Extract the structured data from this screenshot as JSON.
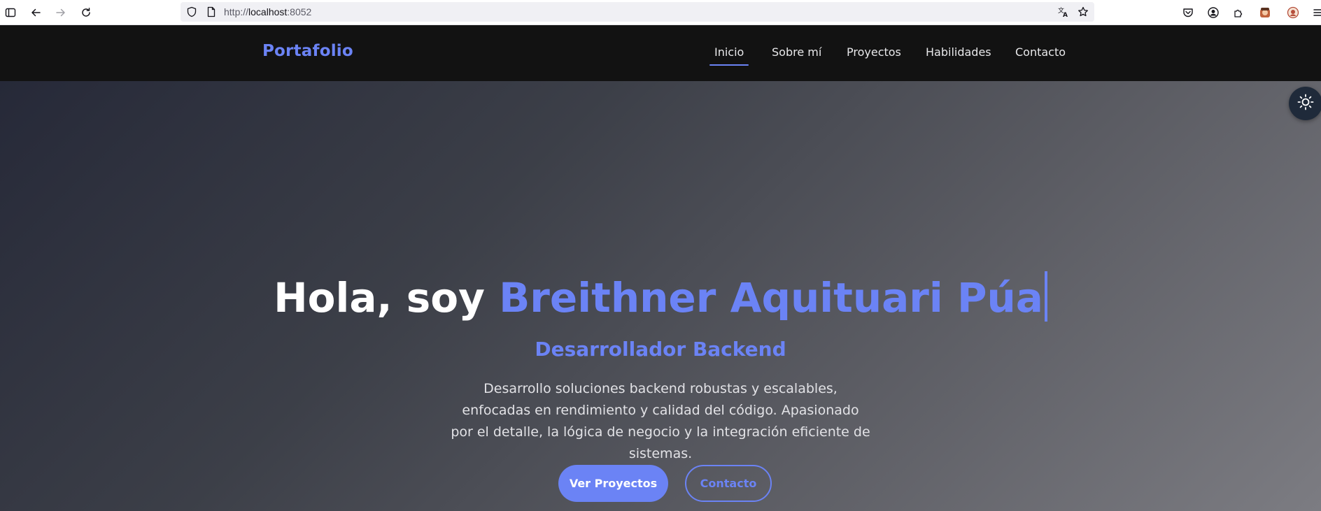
{
  "browser": {
    "url_scheme": "http://",
    "url_host": "localhost",
    "url_port": ":8052"
  },
  "nav": {
    "brand": "Portafolio",
    "links": [
      {
        "label": "Inicio",
        "active": true
      },
      {
        "label": "Sobre mí",
        "active": false
      },
      {
        "label": "Proyectos",
        "active": false
      },
      {
        "label": "Habilidades",
        "active": false
      },
      {
        "label": "Contacto",
        "active": false
      }
    ]
  },
  "hero": {
    "greeting": "Hola, soy ",
    "name": "Breithner Aquituari Púa",
    "subtitle": "Desarrollador Backend",
    "description": "Desarrollo soluciones backend robustas y escalables, enfocadas en rendimiento y calidad del código. Apasionado por el detalle, la lógica de negocio y la integración eficiente de sistemas.",
    "primary_button": "Ver Proyectos",
    "secondary_button": "Contacto"
  },
  "theme_toggle_icon": "sun-icon",
  "colors": {
    "accent": "#6b83f5",
    "nav_bg": "#121212"
  }
}
